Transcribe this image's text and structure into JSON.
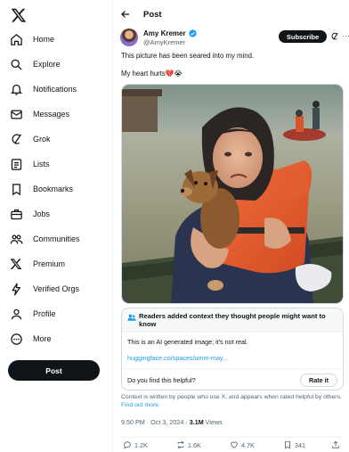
{
  "sidebar": {
    "logo": "x-logo-icon",
    "items": [
      {
        "label": "Home",
        "icon": "home-icon"
      },
      {
        "label": "Explore",
        "icon": "search-icon"
      },
      {
        "label": "Notifications",
        "icon": "bell-icon"
      },
      {
        "label": "Messages",
        "icon": "mail-icon"
      },
      {
        "label": "Grok",
        "icon": "grok-icon"
      },
      {
        "label": "Lists",
        "icon": "list-icon"
      },
      {
        "label": "Bookmarks",
        "icon": "bookmark-icon"
      },
      {
        "label": "Jobs",
        "icon": "briefcase-icon"
      },
      {
        "label": "Communities",
        "icon": "people-icon"
      },
      {
        "label": "Premium",
        "icon": "x-logo-icon"
      },
      {
        "label": "Verified Orgs",
        "icon": "lightning-icon"
      },
      {
        "label": "Profile",
        "icon": "person-icon"
      },
      {
        "label": "More",
        "icon": "more-circle-icon"
      }
    ],
    "post_label": "Post"
  },
  "header": {
    "title": "Post"
  },
  "tweet": {
    "author_name": "Amy Kremer",
    "author_handle": "@AmyKremer",
    "subscribe_label": "Subscribe",
    "text_line1": "This picture has been seared into my mind.",
    "text_line2": "My heart hurts💔😭",
    "timestamp": "9:50 PM · Oct 3, 2024 · ",
    "views_count": "3.1M",
    "views_label": " Views",
    "replies": "1.2K",
    "reposts": "1.6K",
    "likes": "4.7K",
    "bookmarks": "341"
  },
  "community_note": {
    "title": "Readers added context they thought people might want to know",
    "body": "This is an AI generated image; it's not real.",
    "link": "huggingface.co/spaces/umm-may...",
    "question": "Do you find this helpful?",
    "rate_label": "Rate it",
    "disclaimer": "Context is written by people who use X, and appears when rated helpful by others. ",
    "find_out_more": "Find out more."
  },
  "colors": {
    "accent": "#1d9bf0",
    "text": "#0f1419",
    "muted": "#536471",
    "border": "#cfd9de"
  }
}
